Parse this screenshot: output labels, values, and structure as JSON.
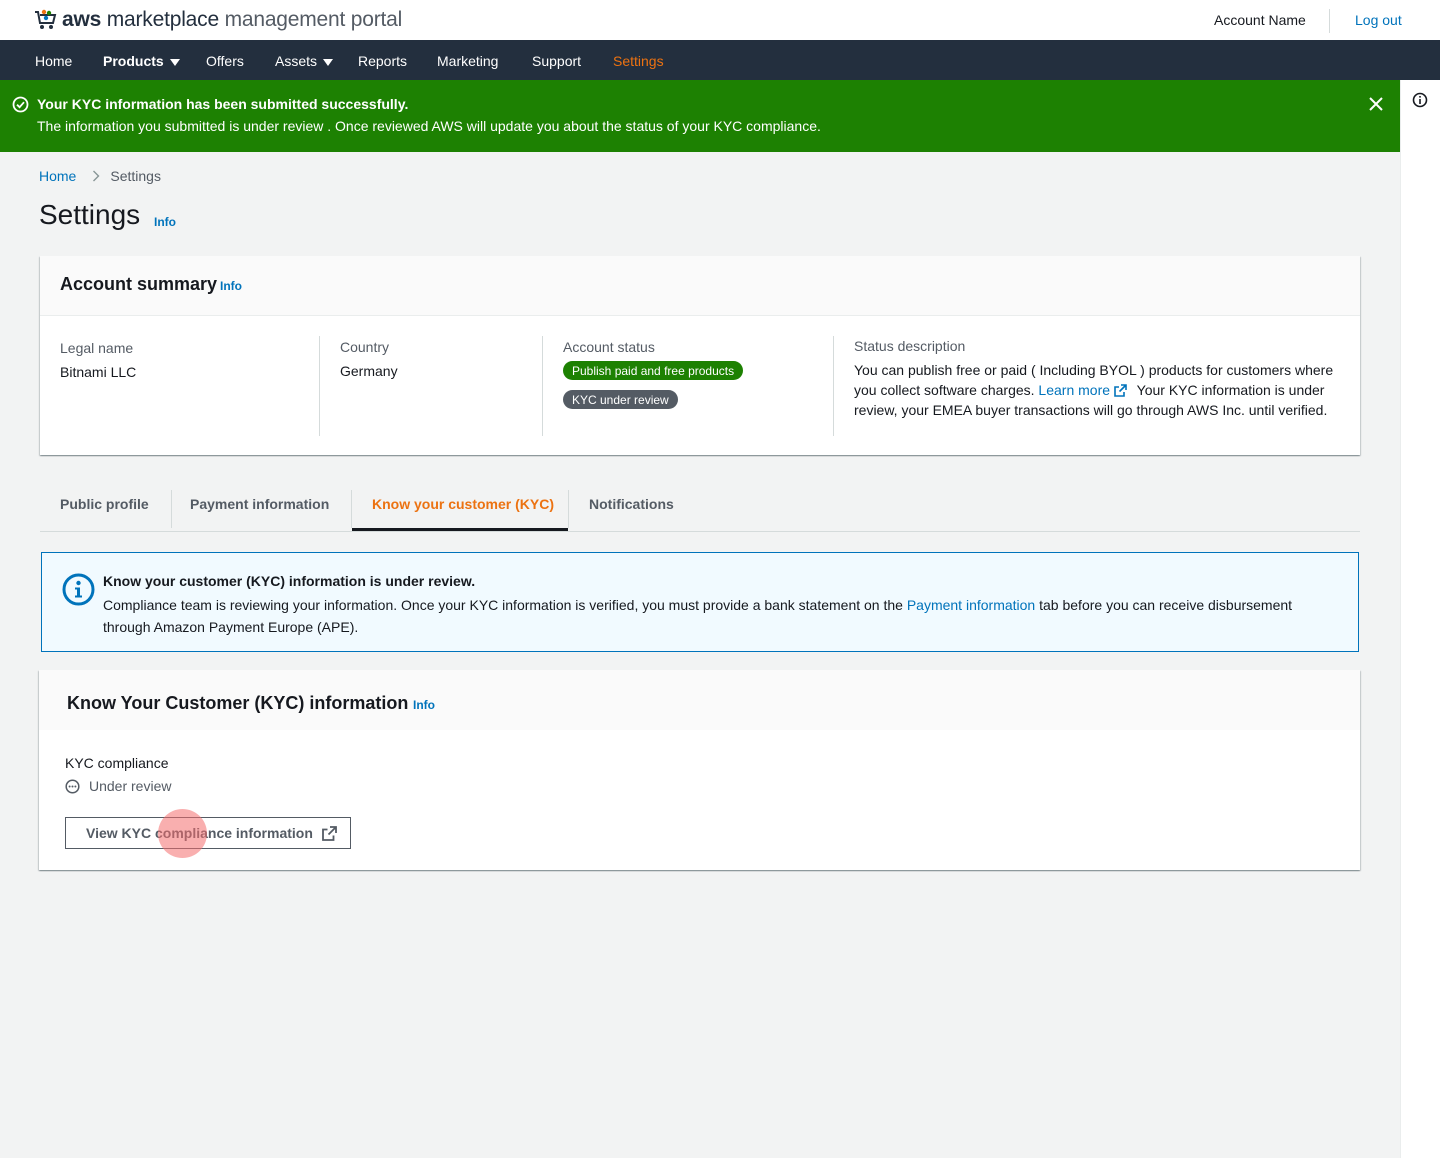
{
  "header": {
    "brand_bold": "aws",
    "brand_mid": "marketplace",
    "brand_light": "management portal",
    "account_name": "Account Name",
    "logout": "Log out"
  },
  "nav": {
    "home": "Home",
    "products": "Products",
    "offers": "Offers",
    "assets": "Assets",
    "reports": "Reports",
    "marketing": "Marketing",
    "support": "Support",
    "settings": "Settings"
  },
  "flash": {
    "title": "Your KYC information has been submitted successfully.",
    "message": "The information you submitted is under review . Once reviewed AWS will update you about the status of your KYC compliance."
  },
  "breadcrumb": {
    "home": "Home",
    "current": "Settings"
  },
  "page": {
    "title": "Settings",
    "info": "Info"
  },
  "account_summary": {
    "title": "Account summary",
    "info": "Info",
    "legal_name_label": "Legal name",
    "legal_name_value": "Bitnami LLC",
    "country_label": "Country",
    "country_value": "Germany",
    "account_status_label": "Account status",
    "badge_publish": "Publish paid and free products",
    "badge_kyc": "KYC under review",
    "status_description_label": "Status description",
    "status_description_part1": "You can publish free or paid ( Including BYOL ) products for customers where you collect software charges.",
    "learn_more": "Learn more",
    "status_description_part2": "Your KYC information is under review, your EMEA buyer transactions will go through AWS Inc. until verified."
  },
  "tabs": {
    "public_profile": "Public profile",
    "payment_information": "Payment information",
    "kyc": "Know your customer (KYC)",
    "notifications": "Notifications"
  },
  "alert": {
    "title": "Know your customer (KYC) information is under review.",
    "text_part1": "Compliance team is reviewing your information. Once your KYC information is verified, you must provide a bank statement on the",
    "link": "Payment information",
    "text_part2": "tab before you can receive disbursement through Amazon Payment Europe (APE)."
  },
  "kyc_card": {
    "title": "Know Your Customer (KYC) information",
    "info": "Info",
    "compliance_label": "KYC compliance",
    "compliance_status": "Under review",
    "view_button": "View KYC compliance information"
  },
  "colors": {
    "nav_bg": "#232f3e",
    "accent": "#ec7211",
    "link": "#0073bb",
    "success": "#1d8102",
    "info_bg": "#f1faff"
  },
  "icons": [
    "cart-logo-icon",
    "caret-down-icon",
    "check-circle-icon",
    "close-icon",
    "info-circle-icon",
    "chevron-right-icon",
    "external-link-icon",
    "status-pending-icon"
  ]
}
